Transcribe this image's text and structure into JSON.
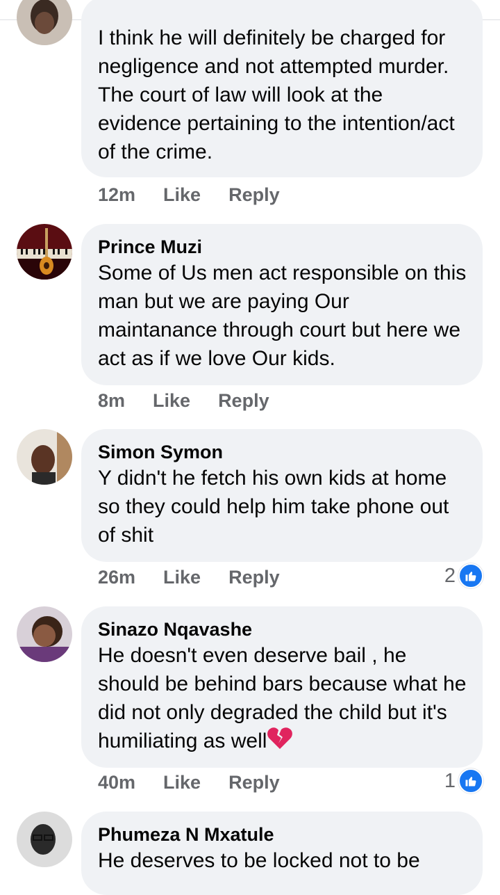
{
  "comments": [
    {
      "author": "",
      "text": "I think he will definitely be charged for negligence and not attempted murder. The court of law will look at the evidence pertaining to the intention/act of the crime.",
      "time": "12m",
      "like_label": "Like",
      "reply_label": "Reply",
      "reactions": ""
    },
    {
      "author": "Prince Muzi",
      "text": "Some of Us men act responsible on this man but we are paying Our maintanance through court but here we act as if we love Our kids.",
      "time": "8m",
      "like_label": "Like",
      "reply_label": "Reply",
      "reactions": ""
    },
    {
      "author": "Simon Symon",
      "text": "Y didn't he fetch his own kids at home so they could help him take phone out of shit",
      "time": "26m",
      "like_label": "Like",
      "reply_label": "Reply",
      "reactions": "2"
    },
    {
      "author": "Sinazo Nqavashe",
      "text": "He doesn't even deserve bail , he should be behind bars because what he did not only degraded the child but it's humiliating as well",
      "time": "40m",
      "like_label": "Like",
      "reply_label": "Reply",
      "reactions": "1"
    },
    {
      "author": "Phumeza N Mxatule",
      "text": "He deserves to be locked not to be",
      "time": "",
      "like_label": "",
      "reply_label": "",
      "reactions": ""
    }
  ],
  "icons": {
    "like": "thumbs-up-icon",
    "emoji": "broken-heart-icon"
  },
  "colors": {
    "bubble": "#f0f2f5",
    "meta_text": "#65676b",
    "like_blue": "#1877f2",
    "broken_heart": "#e0245e"
  }
}
